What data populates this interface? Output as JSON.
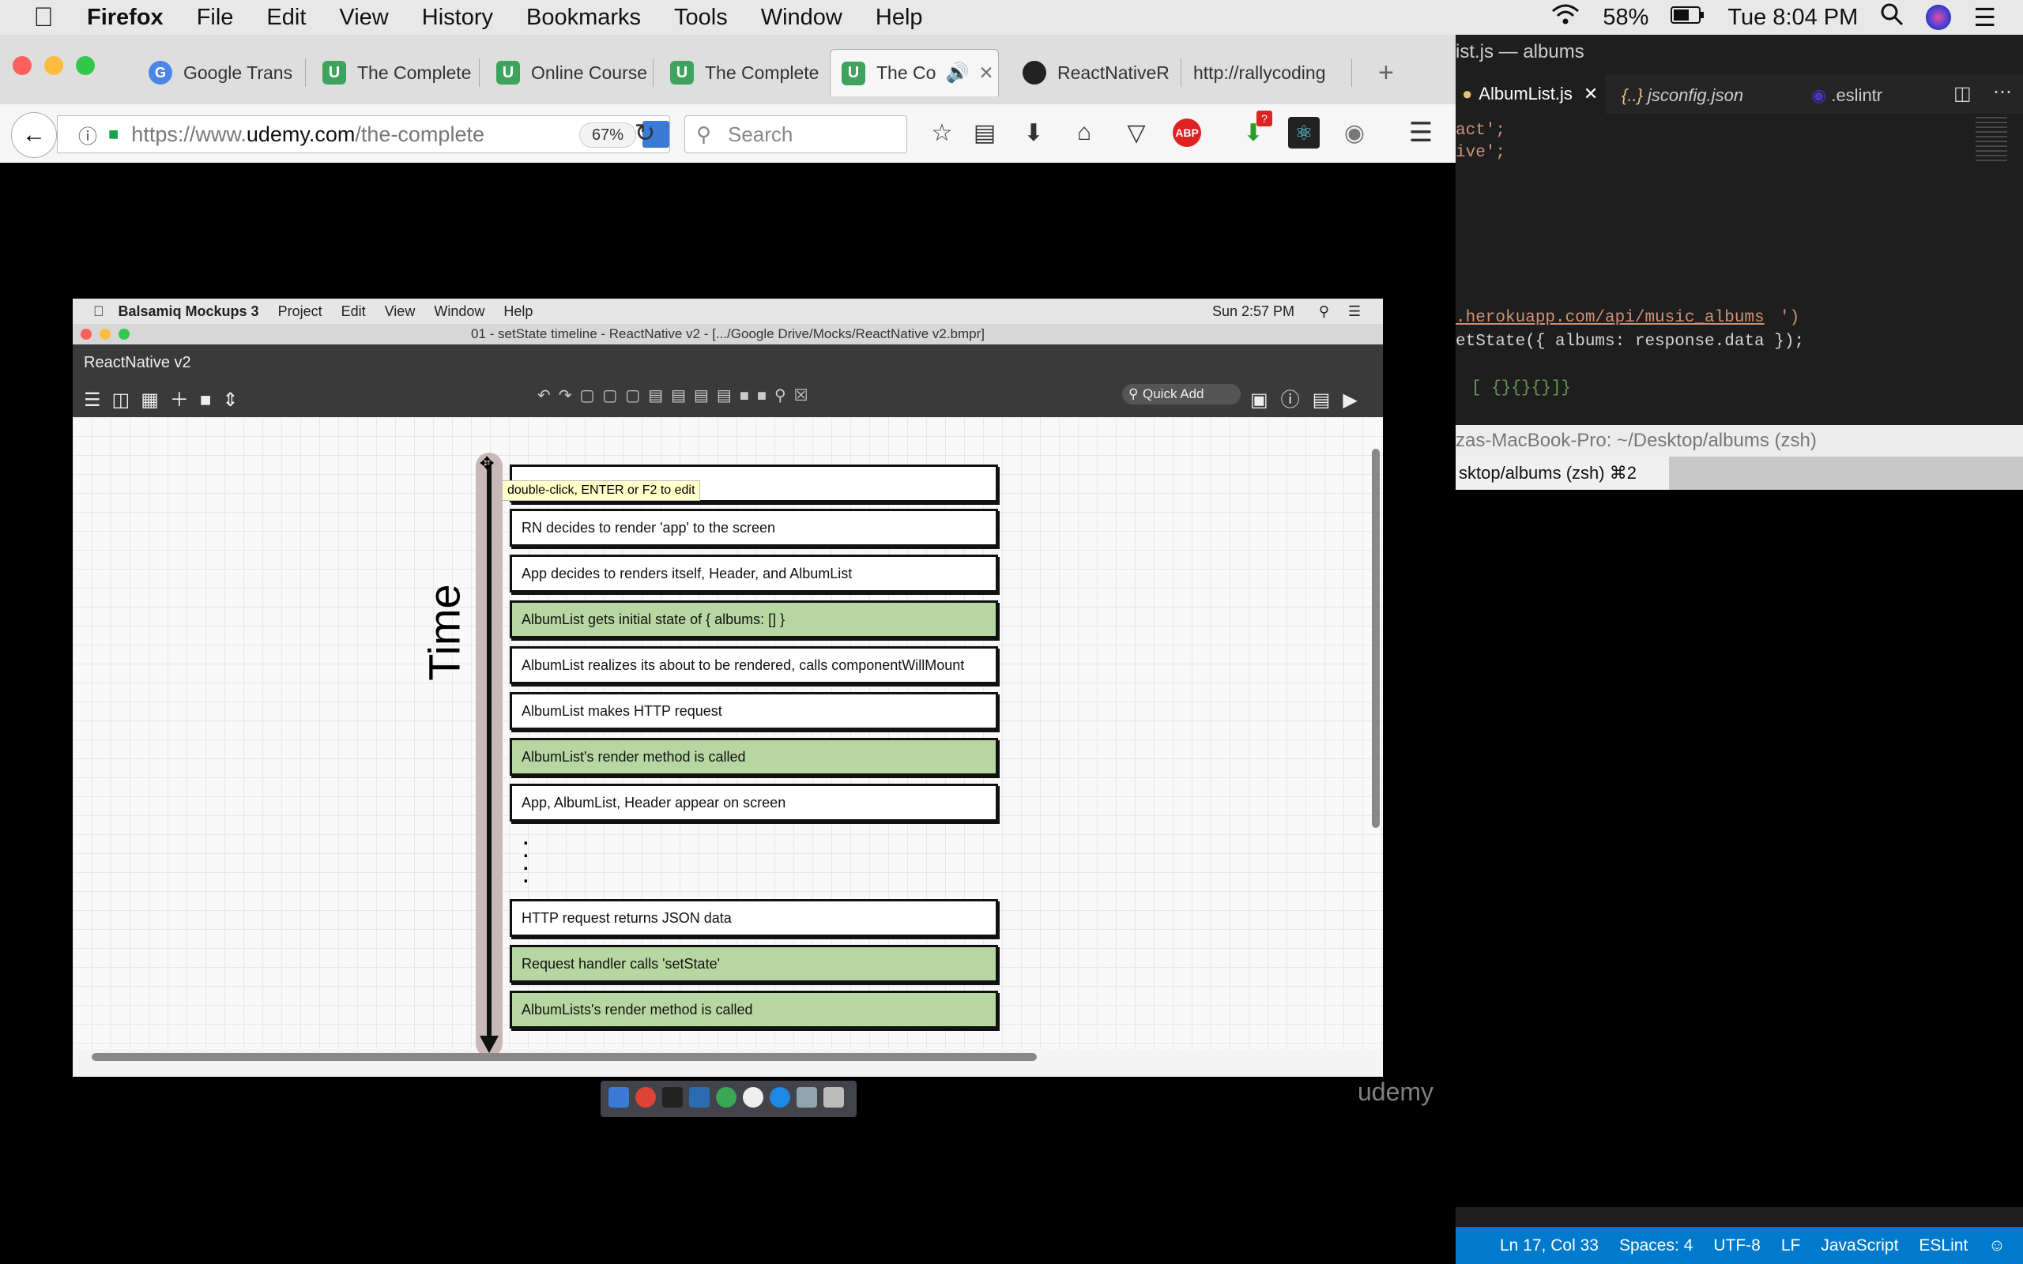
{
  "macos": {
    "app_name": "Firefox",
    "menu": [
      "File",
      "Edit",
      "View",
      "History",
      "Bookmarks",
      "Tools",
      "Window",
      "Help"
    ],
    "battery": "58%",
    "clock": "Tue 8:04 PM"
  },
  "firefox": {
    "tabs": [
      {
        "label": "Google Trans",
        "icon": "google-translate-icon"
      },
      {
        "label": "The Complete",
        "icon": "udemy-icon"
      },
      {
        "label": "Online Course",
        "icon": "udemy-icon"
      },
      {
        "label": "The Complete",
        "icon": "udemy-icon"
      },
      {
        "label": "The Co",
        "icon": "udemy-icon",
        "active": true
      },
      {
        "label": "ReactNativeR",
        "icon": "github-icon"
      },
      {
        "label": "http://rallycoding",
        "icon": ""
      }
    ],
    "new_tab": "+",
    "url_prefix": "https://www.",
    "url_domain": "udemy.com",
    "url_path": "/the-complete",
    "zoom": "67%",
    "search_placeholder": "Search",
    "adblock_label": "ABP",
    "download_badge": "?"
  },
  "balsamiq": {
    "app_name": "Balsamiq Mockups 3",
    "menu": [
      "Project",
      "Edit",
      "View",
      "Window",
      "Help"
    ],
    "clock": "Sun 2:57 PM",
    "window_title": "01 - setState timeline - ReactNative v2 - [.../Google Drive/Mocks/ReactNative v2.bmpr]",
    "project_name": "ReactNative v2",
    "quick_add": "Quick Add",
    "tooltip": "double-click, ENTER or F2 to edit",
    "axis_label": "Time",
    "boxes": [
      {
        "text": "",
        "green": false
      },
      {
        "text": "RN decides to render 'app' to the screen",
        "green": false
      },
      {
        "text": "App decides to renders itself, Header, and AlbumList",
        "green": false
      },
      {
        "text": "AlbumList gets initial state of { albums: [] }",
        "green": true
      },
      {
        "text": "AlbumList realizes its about to be rendered, calls componentWillMount",
        "green": false
      },
      {
        "text": "AlbumList makes HTTP request",
        "green": false
      },
      {
        "text": "AlbumList's render method is called",
        "green": true
      },
      {
        "text": "App, AlbumList, Header appear on screen",
        "green": false
      },
      {
        "text": "HTTP request returns JSON data",
        "green": false
      },
      {
        "text": "Request handler calls 'setState'",
        "green": true
      },
      {
        "text": "AlbumLists's render method is called",
        "green": true
      }
    ],
    "watermark": "udemy",
    "colors": {
      "green": "#b7d7a2",
      "toolbar": "#3a3a3a"
    }
  },
  "vscode": {
    "title": "ist.js — albums",
    "tabs": [
      "AlbumList.js",
      "jsconfig.json",
      ".eslintr"
    ],
    "code_lines": [
      {
        "a": "act';",
        "b": ""
      },
      {
        "a": "ive';",
        "b": ""
      },
      {
        "a": ".herokuapp.com/api/music_albums",
        "b": "')"
      },
      {
        "a": "etState({ albums: response.data });",
        "b": ""
      },
      {
        "a": "[ {}{}{}]}",
        "b": ""
      }
    ],
    "terminal_title": "zas-MacBook-Pro: ~/Desktop/albums (zsh)",
    "terminal_tab": "sktop/albums (zsh)  ⌘2",
    "status": [
      "Ln 17, Col 33",
      "Spaces: 4",
      "UTF-8",
      "LF",
      "JavaScript",
      "ESLint"
    ]
  }
}
